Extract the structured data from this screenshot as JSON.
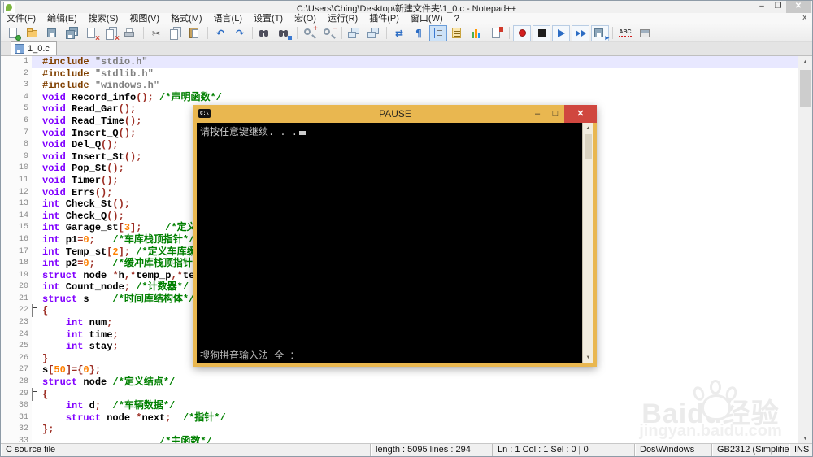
{
  "window": {
    "title": "C:\\Users\\Ching\\Desktop\\新建文件夹\\1_0.c - Notepad++"
  },
  "menu": {
    "items": [
      "文件(F)",
      "编辑(E)",
      "搜索(S)",
      "视图(V)",
      "格式(M)",
      "语言(L)",
      "设置(T)",
      "宏(O)",
      "运行(R)",
      "插件(P)",
      "窗口(W)",
      "?"
    ],
    "close_label": "X"
  },
  "toolbar": {
    "items": [
      {
        "name": "new-file-icon",
        "glyph": "pagenew"
      },
      {
        "name": "open-file-icon",
        "glyph": "folder"
      },
      {
        "name": "save-icon",
        "glyph": "floppy"
      },
      {
        "name": "save-all-icon",
        "glyph": "floppy2"
      },
      {
        "name": "close-file-icon",
        "glyph": "pagex"
      },
      {
        "name": "close-all-icon",
        "glyph": "pagex2"
      },
      {
        "name": "print-icon",
        "glyph": "printer"
      },
      "sep",
      {
        "name": "cut-icon",
        "glyph": "scissors"
      },
      {
        "name": "copy-icon",
        "glyph": "pages"
      },
      {
        "name": "paste-icon",
        "glyph": "clipboard"
      },
      "sep",
      {
        "name": "undo-icon",
        "glyph": "undo"
      },
      {
        "name": "redo-icon",
        "glyph": "redo"
      },
      "sep",
      {
        "name": "find-icon",
        "glyph": "binoc"
      },
      {
        "name": "replace-icon",
        "glyph": "binoc2"
      },
      "sep",
      {
        "name": "zoom-in-icon",
        "glyph": "zin"
      },
      {
        "name": "zoom-out-icon",
        "glyph": "zout"
      },
      "sep",
      {
        "name": "sync-vertical-scroll-icon",
        "glyph": "winpair"
      },
      {
        "name": "sync-horizontal-scroll-icon",
        "glyph": "winpair"
      },
      "sep",
      {
        "name": "word-wrap-icon",
        "glyph": "wrap"
      },
      {
        "name": "show-all-characters-icon",
        "glyph": "pilcrow"
      },
      {
        "name": "indent-guide-icon",
        "glyph": "indent",
        "pressed": true
      },
      {
        "name": "function-list-icon",
        "glyph": "funclist"
      },
      {
        "name": "document-map-icon",
        "glyph": "docmap"
      },
      {
        "name": "monitoring-icon",
        "glyph": "macrodoc"
      },
      "sep",
      {
        "name": "record-macro-icon",
        "glyph": "record",
        "framed": true
      },
      {
        "name": "stop-recording-icon",
        "glyph": "stop",
        "framed": true
      },
      {
        "name": "play-macro-icon",
        "glyph": "play",
        "framed": true
      },
      {
        "name": "run-macro-multiple-icon",
        "glyph": "playmulti",
        "framed": true
      },
      {
        "name": "save-recorded-macro-icon",
        "glyph": "savemacro",
        "framed": true
      },
      "sep",
      {
        "name": "spell-check-icon",
        "glyph": "abc"
      },
      {
        "name": "document-switcher-icon",
        "glyph": "docswitch"
      }
    ]
  },
  "tabs": [
    {
      "label": "1_0.c"
    }
  ],
  "editor": {
    "lines": [
      {
        "n": "1",
        "f": "",
        "cur": true,
        "s": [
          [
            "p",
            "#include "
          ],
          [
            "s",
            "\"stdio.h\""
          ]
        ]
      },
      {
        "n": "2",
        "f": "",
        "s": [
          [
            "p",
            "#include "
          ],
          [
            "s",
            "\"stdlib.h\""
          ]
        ]
      },
      {
        "n": "3",
        "f": "",
        "s": [
          [
            "p",
            "#include "
          ],
          [
            "s",
            "\"windows.h\""
          ]
        ]
      },
      {
        "n": "4",
        "f": "",
        "s": [
          [
            "k",
            "void"
          ],
          [
            "t",
            " Record_info"
          ],
          [
            "o",
            "();"
          ],
          [
            "c",
            " /*声明函数*/"
          ]
        ]
      },
      {
        "n": "5",
        "f": "",
        "s": [
          [
            "k",
            "void"
          ],
          [
            "t",
            " Read_Gar"
          ],
          [
            "o",
            "();"
          ]
        ]
      },
      {
        "n": "6",
        "f": "",
        "s": [
          [
            "k",
            "void"
          ],
          [
            "t",
            " Read_Time"
          ],
          [
            "o",
            "();"
          ]
        ]
      },
      {
        "n": "7",
        "f": "",
        "s": [
          [
            "k",
            "void"
          ],
          [
            "t",
            " Insert_Q"
          ],
          [
            "o",
            "();"
          ]
        ]
      },
      {
        "n": "8",
        "f": "",
        "s": [
          [
            "k",
            "void"
          ],
          [
            "t",
            " Del_Q"
          ],
          [
            "o",
            "();"
          ]
        ]
      },
      {
        "n": "9",
        "f": "",
        "s": [
          [
            "k",
            "void"
          ],
          [
            "t",
            " Insert_St"
          ],
          [
            "o",
            "();"
          ]
        ]
      },
      {
        "n": "10",
        "f": "",
        "s": [
          [
            "k",
            "void"
          ],
          [
            "t",
            " Pop_St"
          ],
          [
            "o",
            "();"
          ]
        ]
      },
      {
        "n": "11",
        "f": "",
        "s": [
          [
            "k",
            "void"
          ],
          [
            "t",
            " Timer"
          ],
          [
            "o",
            "();"
          ]
        ]
      },
      {
        "n": "12",
        "f": "",
        "s": [
          [
            "k",
            "void"
          ],
          [
            "t",
            " Errs"
          ],
          [
            "o",
            "();"
          ]
        ]
      },
      {
        "n": "13",
        "f": "",
        "s": [
          [
            "k",
            "int"
          ],
          [
            "t",
            " Check_St"
          ],
          [
            "o",
            "();"
          ]
        ]
      },
      {
        "n": "14",
        "f": "",
        "s": [
          [
            "k",
            "int"
          ],
          [
            "t",
            " Check_Q"
          ],
          [
            "o",
            "();"
          ]
        ]
      },
      {
        "n": "15",
        "f": "",
        "s": [
          [
            "k",
            "int"
          ],
          [
            "t",
            " Garage_st"
          ],
          [
            "o",
            "["
          ],
          [
            "n",
            "3"
          ],
          [
            "o",
            "];"
          ],
          [
            "c",
            "    /*定义车库栈*/"
          ]
        ]
      },
      {
        "n": "16",
        "f": "",
        "s": [
          [
            "k",
            "int"
          ],
          [
            "t",
            " p1"
          ],
          [
            "o",
            "="
          ],
          [
            "n",
            "0"
          ],
          [
            "o",
            ";"
          ],
          [
            "c",
            "   /*车库栈顶指针*/"
          ]
        ]
      },
      {
        "n": "17",
        "f": "",
        "s": [
          [
            "k",
            "int"
          ],
          [
            "t",
            " Temp_st"
          ],
          [
            "o",
            "["
          ],
          [
            "n",
            "2"
          ],
          [
            "o",
            "];"
          ],
          [
            "c",
            " /*定义车库缓冲*/"
          ]
        ]
      },
      {
        "n": "18",
        "f": "",
        "s": [
          [
            "k",
            "int"
          ],
          [
            "t",
            " p2"
          ],
          [
            "o",
            "="
          ],
          [
            "n",
            "0"
          ],
          [
            "o",
            ";"
          ],
          [
            "c",
            "   /*缓冲库栈顶指针*/"
          ]
        ]
      },
      {
        "n": "19",
        "f": "",
        "s": [
          [
            "k",
            "struct"
          ],
          [
            "t",
            " node "
          ],
          [
            "o",
            "*"
          ],
          [
            "t",
            "h"
          ],
          [
            "o",
            ",*"
          ],
          [
            "t",
            "temp_p"
          ],
          [
            "o",
            ",*"
          ],
          [
            "t",
            "temp_q"
          ],
          [
            "o",
            ";"
          ]
        ]
      },
      {
        "n": "20",
        "f": "",
        "s": [
          [
            "k",
            "int"
          ],
          [
            "t",
            " Count_node"
          ],
          [
            "o",
            ";"
          ],
          [
            "c",
            " /*计数器*/"
          ]
        ]
      },
      {
        "n": "21",
        "f": "",
        "s": [
          [
            "k",
            "struct"
          ],
          [
            "t",
            " s"
          ],
          [
            "c",
            "    /*时间库结构体*/"
          ]
        ]
      },
      {
        "n": "22",
        "f": "o",
        "s": [
          [
            "o",
            "{"
          ]
        ]
      },
      {
        "n": "23",
        "f": "l",
        "s": [
          [
            "t",
            "    "
          ],
          [
            "k",
            "int"
          ],
          [
            "t",
            " num"
          ],
          [
            "o",
            ";"
          ]
        ]
      },
      {
        "n": "24",
        "f": "l",
        "s": [
          [
            "t",
            "    "
          ],
          [
            "k",
            "int"
          ],
          [
            "t",
            " time"
          ],
          [
            "o",
            ";"
          ]
        ]
      },
      {
        "n": "25",
        "f": "l",
        "s": [
          [
            "t",
            "    "
          ],
          [
            "k",
            "int"
          ],
          [
            "t",
            " stay"
          ],
          [
            "o",
            ";"
          ]
        ]
      },
      {
        "n": "26",
        "f": "e",
        "s": [
          [
            "o",
            "}"
          ]
        ]
      },
      {
        "n": "27",
        "f": "",
        "s": [
          [
            "t",
            "s"
          ],
          [
            "o",
            "["
          ],
          [
            "n",
            "50"
          ],
          [
            "o",
            "]={"
          ],
          [
            "n",
            "0"
          ],
          [
            "o",
            "};"
          ]
        ]
      },
      {
        "n": "28",
        "f": "",
        "s": [
          [
            "k",
            "struct"
          ],
          [
            "t",
            " node "
          ],
          [
            "c",
            "/*定义结点*/"
          ]
        ]
      },
      {
        "n": "29",
        "f": "o",
        "s": [
          [
            "o",
            "{"
          ]
        ]
      },
      {
        "n": "30",
        "f": "l",
        "s": [
          [
            "t",
            "    "
          ],
          [
            "k",
            "int"
          ],
          [
            "t",
            " d"
          ],
          [
            "o",
            ";"
          ],
          [
            "c",
            "  /*车辆数据*/"
          ]
        ]
      },
      {
        "n": "31",
        "f": "l",
        "s": [
          [
            "t",
            "    "
          ],
          [
            "k",
            "struct"
          ],
          [
            "t",
            " node "
          ],
          [
            "o",
            "*"
          ],
          [
            "t",
            "next"
          ],
          [
            "o",
            ";"
          ],
          [
            "c",
            "  /*指针*/"
          ]
        ]
      },
      {
        "n": "32",
        "f": "e",
        "s": [
          [
            "o",
            "};"
          ]
        ]
      },
      {
        "n": "33",
        "f": "",
        "s": [
          [
            "t",
            "                    "
          ],
          [
            "c",
            "/*主函数*/"
          ]
        ]
      }
    ]
  },
  "console": {
    "title": "PAUSE",
    "icon_label": "C:\\",
    "line1": "请按任意键继续. . .",
    "status_line": "搜狗拼音输入法 全 ：",
    "titlebar_color": "#E9B750",
    "close_color": "#D0473F"
  },
  "statusbar": {
    "doctype": "C source file",
    "length_info": "length : 5095    lines : 294",
    "cursor_info": "Ln : 1    Col : 1    Sel : 0 | 0",
    "eol": "Dos\\Windows",
    "encoding": "GB2312 (Simplified)",
    "mode": "INS"
  },
  "watermark": {
    "brand": "Baidu",
    "suffix": "经验",
    "url": "jingyan.baidu.com"
  }
}
